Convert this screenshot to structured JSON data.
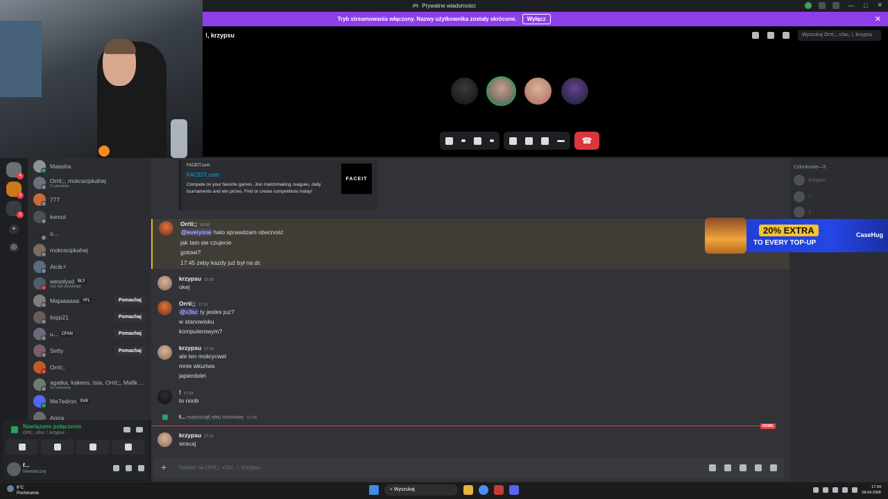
{
  "window": {
    "title": "Prywatne wiadomości"
  },
  "banner": {
    "text": "Tryb streamowania włączony. Nazwy użytkownika zostały skrócone.",
    "button": "Wyłącz"
  },
  "call": {
    "title": "!, krzypsu",
    "search_placeholder": "Wyszukaj Orrti;;, x3sc, !, krzypsu"
  },
  "dm_list": [
    {
      "name": "Maasha",
      "status": "on"
    },
    {
      "name": "Orrti;;, mokracipkahej",
      "sub": "3 członków"
    },
    {
      "name": "777",
      "status": "off"
    },
    {
      "name": "kemol",
      "status": "off"
    },
    {
      "name": "o...",
      "status": "off"
    },
    {
      "name": "mokracipkahej",
      "status": "off"
    },
    {
      "name": "Alcik⚡",
      "status": "off"
    },
    {
      "name": "wesolyxd",
      "tag": "BLY",
      "sub": "IDE NA UKRAINE!",
      "status": "dnd"
    },
    {
      "name": "Majaaaaaa",
      "tag": "YFL",
      "help": "Pomachaj",
      "status": "off"
    },
    {
      "name": "livpp21",
      "help": "Pomachaj",
      "status": "off"
    },
    {
      "name": "u...",
      "tag": "CFAN",
      "help": "Pomachaj",
      "status": "off"
    },
    {
      "name": "Setty",
      "help": "Pomachaj",
      "status": "off"
    },
    {
      "name": "Orrti;;",
      "status": "dnd"
    },
    {
      "name": "agatka, kakens, Isia, Orrti;;, Mafik ...",
      "sub": "10 członków"
    },
    {
      "name": "Me7edron",
      "tag": "SVK",
      "status": "on"
    },
    {
      "name": "Amra",
      "status": "off"
    }
  ],
  "voice_panel": {
    "status": "Nawiązano połączenie",
    "members": "Orrti;;, x3sc, !, krzypsu"
  },
  "user_panel": {
    "name": "f...",
    "status": "Niewidoczny"
  },
  "embed": {
    "provider": "FACEIT.com",
    "title": "FACEIT.com",
    "description": "Compete on your favorite games. Join matchmaking, leagues, daily tournaments and win prizes. Find or create competitions today!",
    "thumb": "FACEIT"
  },
  "messages": [
    {
      "author": "Orrti;;",
      "time": "16:58",
      "mention": "@everyone",
      "lines": [
        "halo sprawdzam obecność",
        "jak tam sie czujecie",
        "gotowi?",
        "17:45 zeby kazdy już był na dc"
      ]
    },
    {
      "author": "krzypsu",
      "time": "16:58",
      "lines": [
        "okej"
      ]
    },
    {
      "author": "Orrti;;",
      "time": "17:21",
      "mention": "@x3sc",
      "lines": [
        "ty jestes juz?",
        "w stanowisku",
        "komputerowym?"
      ]
    },
    {
      "author": "krzypsu",
      "time": "17:22",
      "lines": [
        "ale ten mokrycwel",
        "mnie wkuriwa",
        "japierdole\\"
      ]
    },
    {
      "author": "!",
      "time": "17:23",
      "lines": [
        "to noob"
      ]
    },
    {
      "author": "krzypsu",
      "time": "17:31",
      "lines": [
        "wracaj"
      ]
    }
  ],
  "system_message": {
    "actor": "f...",
    "text": "rozpoczął(-ęła) rozmowę.",
    "time": "17:29"
  },
  "new_label": "NOWE",
  "composer": {
    "placeholder": "Napisz na Orrti;;, x3sc, !, krzypsu"
  },
  "members": {
    "header": "Członkowie—5",
    "names": [
      "krzypsu",
      "!",
      "f..."
    ]
  },
  "ad": {
    "headline": "20% EXTRA",
    "sub": "TO EVERY TOP-UP",
    "brand": "CaseHug"
  },
  "taskbar": {
    "weather_temp": "6°C",
    "weather_desc": "Pochmurnie",
    "search": "Wyszukaj",
    "time": "17:34",
    "date": "09.04.2026"
  }
}
